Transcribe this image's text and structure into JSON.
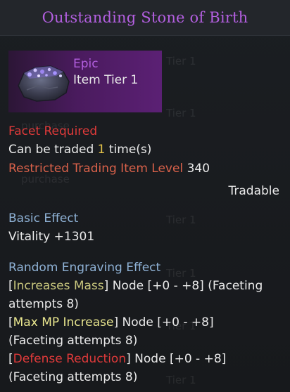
{
  "item": {
    "title": "Outstanding Stone of Birth",
    "grade": "Epic",
    "tier": "Item Tier 1",
    "facet_required": "Facet Required",
    "trade_prefix": "Can be traded",
    "trade_count": "1",
    "trade_suffix": "time(s)",
    "restricted_label": "Restricted Trading Item Level",
    "restricted_value": "340",
    "tradable": "Tradable",
    "basic_effect_label": "Basic Effect",
    "basic_effect_value": "Vitality +1301",
    "random_effect_label": "Random Engraving Effect",
    "engravings": [
      {
        "open": "[",
        "name": "Increases Mass",
        "close": "]",
        "rest1": " Node [+0 - +8] (Faceting",
        "rest2": "attempts 8)"
      },
      {
        "open": "[",
        "name": "Max MP Increase",
        "close": "]",
        "rest1": " Node [+0 - +8]",
        "rest2": "(Faceting attempts 8)"
      },
      {
        "open": "[",
        "name": "Defense Reduction",
        "close": "]",
        "rest1": " Node [+0 - +8]",
        "rest2": "(Faceting attempts 8)"
      }
    ]
  },
  "background_list": {
    "tier_label": "Tier 1",
    "purchase_label": "purchase"
  },
  "colors": {
    "epic": "#b35fe0",
    "required": "#e03a3a",
    "restricted": "#d9614a",
    "count": "#e5c44a",
    "section": "#8fb2d6",
    "negative_engraving": "#e03a3a"
  },
  "icons": {
    "item": "purple-stone-icon"
  }
}
